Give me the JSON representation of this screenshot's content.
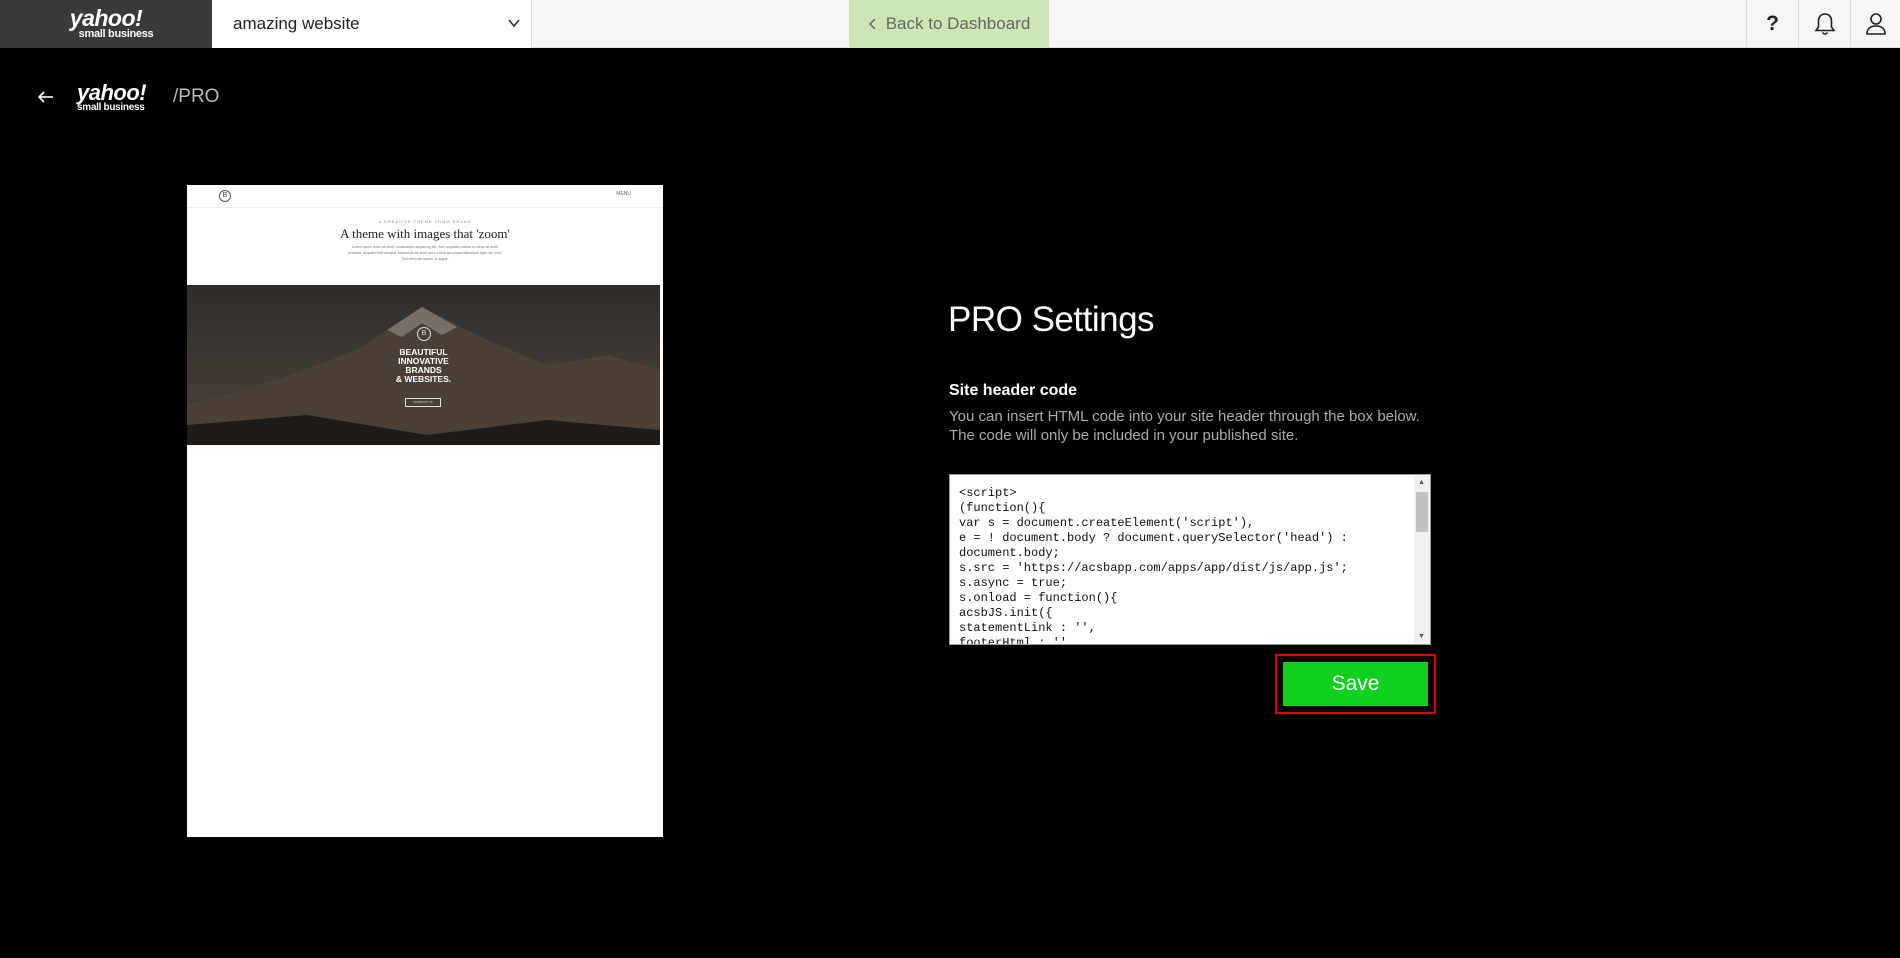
{
  "topbar": {
    "brand_yahoo": "yahoo!",
    "brand_sub": "small business",
    "site_name": "amazing website",
    "back_label": "Back to Dashboard",
    "help_label": "?"
  },
  "subheader": {
    "brand_yahoo": "yahoo!",
    "brand_sub": "small business",
    "pro_tag": "/PRO"
  },
  "preview": {
    "nav_menu": "MENU",
    "kicker": "A CREATIVE THEME FROM BRAND",
    "title": "A theme with images that 'zoom'",
    "paragraph": "Lorem ipsum dolor sit amet, consectetur adipiscing elit. Sed vulputate massa eu tortor sit amet pharetra. Aliquam erat volutpat. Maecenas sit amet urna a sem accumsan bibendum eget nec nibh. Sed vehicula mauris ut augue.",
    "hero_lines": [
      "BEAUTIFUL",
      "INNOVATIVE",
      "BRANDS",
      "& WEBSITES."
    ],
    "hero_button": "CONTACT US"
  },
  "settings": {
    "title": "PRO Settings",
    "section_label": "Site header code",
    "description": "You can insert HTML code into your site header through the box below. The code will only be included in your published site.",
    "code_value": "<script>\n(function(){\nvar s = document.createElement('script'),\ne = ! document.body ? document.querySelector('head') :\ndocument.body;\ns.src = 'https://acsbapp.com/apps/app/dist/js/app.js';\ns.async = true;\ns.onload = function(){\nacsbJS.init({\nstatementLink : '',\nfooterHtml : '',",
    "save_label": "Save"
  },
  "colors": {
    "save_green": "#0fcf1f",
    "highlight_red": "#e00000",
    "back_button_bg": "#cde6b5"
  }
}
